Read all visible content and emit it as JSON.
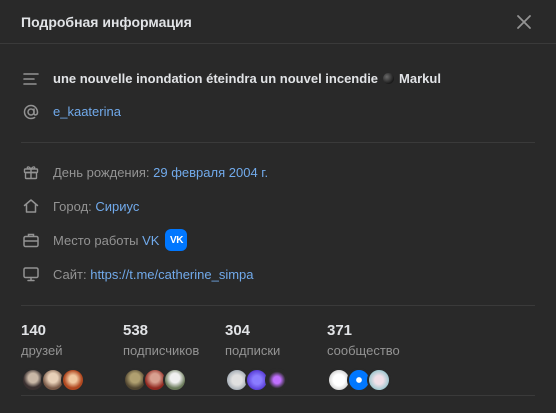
{
  "header": {
    "title": "Подробная информация"
  },
  "status": {
    "text": "une nouvelle inondation éteindra un nouvel incendie",
    "artist": "Markul"
  },
  "username": "e_kaaterina",
  "details": {
    "birthday_label": "День рождения:",
    "birthday_value": "29 февраля 2004 г.",
    "city_label": "Город:",
    "city_value": "Сириус",
    "work_label": "Место работы",
    "work_value": "VK",
    "work_badge": "VK",
    "site_label": "Сайт:",
    "site_value": "https://t.me/catherine_simpa"
  },
  "stats": [
    {
      "count": "140",
      "label": "друзей"
    },
    {
      "count": "538",
      "label": "подписчиков"
    },
    {
      "count": "304",
      "label": "подписки"
    },
    {
      "count": "371",
      "label": "сообщество"
    }
  ],
  "icons": {
    "close": "close-icon",
    "status": "text-lines-icon",
    "username": "at-sign-icon",
    "birthday": "gift-icon",
    "city": "home-icon",
    "work": "briefcase-icon",
    "site": "monitor-icon"
  },
  "colors": {
    "background": "#292929",
    "link": "#71aaeb",
    "muted": "#939393",
    "text": "#e1e3e6",
    "vk_blue": "#0077ff"
  }
}
